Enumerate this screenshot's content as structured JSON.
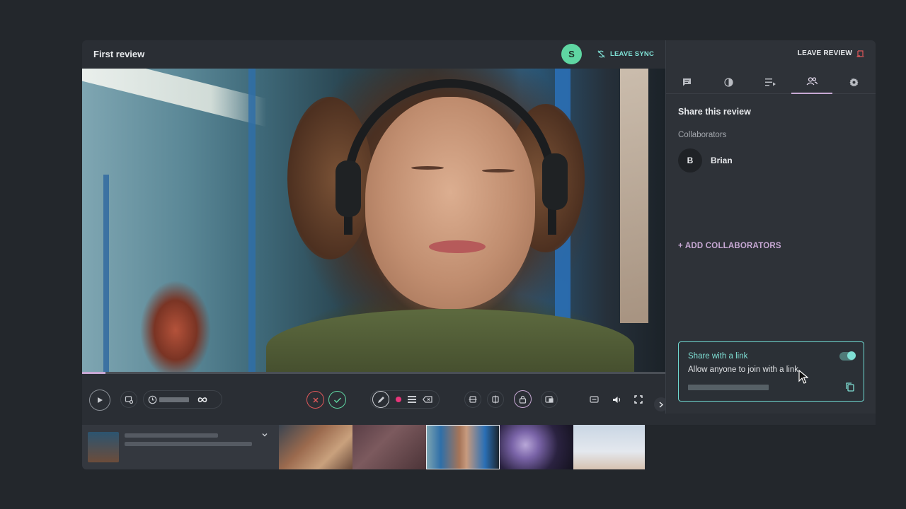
{
  "header": {
    "title": "First review",
    "user_initial": "S",
    "leave_sync_label": "LEAVE SYNC",
    "leave_review_label": "LEAVE REVIEW"
  },
  "player": {
    "progress_fraction": 0.04
  },
  "panel": {
    "tabs": [
      {
        "icon": "comment-icon"
      },
      {
        "icon": "contrast-icon"
      },
      {
        "icon": "playlist-icon"
      },
      {
        "icon": "users-icon",
        "active": true
      },
      {
        "icon": "gear-icon"
      }
    ],
    "share_title": "Share this review",
    "collaborators_label": "Collaborators",
    "collaborators": [
      {
        "initial": "B",
        "name": "Brian"
      }
    ],
    "add_collaborators_label": "+ ADD COLLABORATORS",
    "share_link": {
      "title": "Share with a link",
      "description": "Allow anyone to join with a link",
      "enabled": true
    }
  },
  "colors": {
    "accent_teal": "#7fe0d5",
    "accent_purple": "#c7a8d4",
    "avatar_green": "#5fd6a2",
    "reject_red": "#e0585a",
    "approve_green": "#5fd6a2",
    "record_pink": "#e8357a"
  }
}
